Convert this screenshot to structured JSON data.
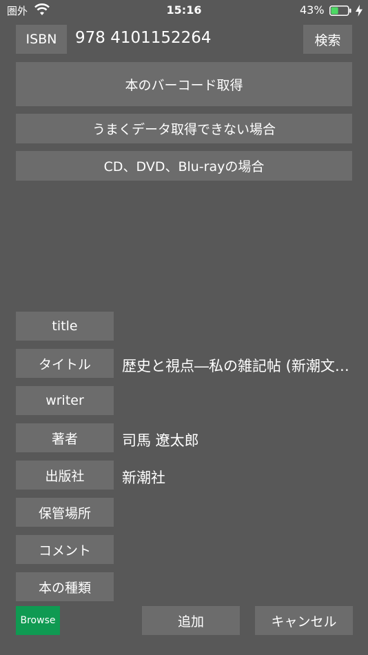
{
  "status_bar": {
    "carrier": "圏外",
    "time": "15:16",
    "battery_percent": "43%",
    "battery_level": 0.43,
    "battery_color": "#4cd964"
  },
  "isbn": {
    "label": "ISBN",
    "value": "978 4101152264",
    "search_label": "検索"
  },
  "actions": {
    "barcode": "本のバーコード取得",
    "fallback": "うまくデータ取得できない場合",
    "media": "CD、DVD、Blu-rayの場合"
  },
  "fields": {
    "title_label": "title",
    "title_value": "",
    "jtitle_label": "タイトル",
    "jtitle_value": "歴史と視点―私の雑記帖 (新潮文庫)",
    "writer_label": "writer",
    "writer_value": "",
    "author_label": "著者",
    "author_value": "司馬 遼太郎",
    "publisher_label": "出版社",
    "publisher_value": "新潮社",
    "location_label": "保管場所",
    "location_value": "",
    "comment_label": "コメント",
    "comment_value": "",
    "type_label": "本の種類",
    "type_value": ""
  },
  "footer": {
    "browse": "Browse",
    "add": "追加",
    "cancel": "キャンセル",
    "browse_color": "#0f9a52"
  }
}
